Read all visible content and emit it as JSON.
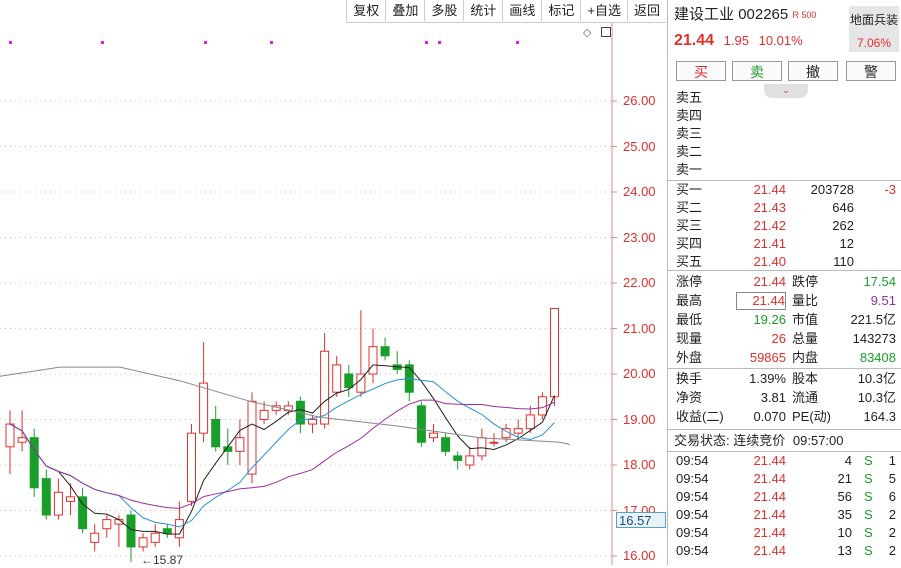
{
  "toolbar": [
    "复权",
    "叠加",
    "多股",
    "统计",
    "画线",
    "标记",
    "+自选",
    "返回"
  ],
  "axis": {
    "ticks": [
      "26.00",
      "25.00",
      "24.00",
      "23.00",
      "22.00",
      "21.00",
      "20.00",
      "19.00",
      "18.00",
      "17.00",
      "16.00"
    ],
    "current_price": "16.57",
    "low_label": "15.87"
  },
  "chart_data": {
    "type": "candlestick",
    "ylim": [
      15.8,
      26.6
    ],
    "price_ticks": [
      26,
      25,
      24,
      23,
      22,
      21,
      20,
      19,
      18,
      17,
      16
    ],
    "candles": [
      {
        "o": 18.4,
        "c": 18.9,
        "h": 19.2,
        "l": 17.8
      },
      {
        "o": 18.5,
        "c": 18.6,
        "h": 19.2,
        "l": 18.3
      },
      {
        "o": 18.6,
        "c": 17.5,
        "h": 18.8,
        "l": 17.3
      },
      {
        "o": 17.7,
        "c": 16.9,
        "h": 17.9,
        "l": 16.8
      },
      {
        "o": 16.9,
        "c": 17.4,
        "h": 17.7,
        "l": 16.8
      },
      {
        "o": 17.2,
        "c": 17.3,
        "h": 17.6,
        "l": 16.9
      },
      {
        "o": 17.3,
        "c": 16.6,
        "h": 17.5,
        "l": 16.5
      },
      {
        "o": 16.3,
        "c": 16.5,
        "h": 16.7,
        "l": 16.1
      },
      {
        "o": 16.6,
        "c": 16.8,
        "h": 16.9,
        "l": 16.4
      },
      {
        "o": 16.7,
        "c": 16.8,
        "h": 16.9,
        "l": 16.2
      },
      {
        "o": 16.9,
        "c": 16.2,
        "h": 17.0,
        "l": 15.87
      },
      {
        "o": 16.2,
        "c": 16.4,
        "h": 16.5,
        "l": 16.1
      },
      {
        "o": 16.3,
        "c": 16.5,
        "h": 16.7,
        "l": 16.2
      },
      {
        "o": 16.6,
        "c": 16.5,
        "h": 16.7,
        "l": 16.4
      },
      {
        "o": 16.4,
        "c": 16.8,
        "h": 17.2,
        "l": 16.2
      },
      {
        "o": 17.2,
        "c": 18.7,
        "h": 18.9,
        "l": 17.1
      },
      {
        "o": 18.7,
        "c": 19.8,
        "h": 20.7,
        "l": 18.5
      },
      {
        "o": 19.0,
        "c": 18.4,
        "h": 19.3,
        "l": 18.3
      },
      {
        "o": 18.4,
        "c": 18.3,
        "h": 18.8,
        "l": 18.0
      },
      {
        "o": 18.3,
        "c": 18.6,
        "h": 19.0,
        "l": 18.0
      },
      {
        "o": 17.8,
        "c": 19.4,
        "h": 19.6,
        "l": 17.6
      },
      {
        "o": 19.0,
        "c": 19.2,
        "h": 19.4,
        "l": 18.9
      },
      {
        "o": 19.2,
        "c": 19.3,
        "h": 19.4,
        "l": 19.1
      },
      {
        "o": 19.2,
        "c": 19.3,
        "h": 19.4,
        "l": 19.1
      },
      {
        "o": 19.4,
        "c": 18.9,
        "h": 19.5,
        "l": 18.7
      },
      {
        "o": 18.9,
        "c": 19.0,
        "h": 19.1,
        "l": 18.7
      },
      {
        "o": 18.9,
        "c": 20.5,
        "h": 20.9,
        "l": 18.8
      },
      {
        "o": 19.6,
        "c": 20.2,
        "h": 20.4,
        "l": 19.5
      },
      {
        "o": 20.0,
        "c": 19.7,
        "h": 20.2,
        "l": 19.5
      },
      {
        "o": 19.6,
        "c": 20.0,
        "h": 21.4,
        "l": 19.5
      },
      {
        "o": 20.0,
        "c": 20.6,
        "h": 21.0,
        "l": 19.8
      },
      {
        "o": 20.6,
        "c": 20.4,
        "h": 20.8,
        "l": 20.3
      },
      {
        "o": 20.2,
        "c": 20.1,
        "h": 20.5,
        "l": 20.0
      },
      {
        "o": 20.2,
        "c": 19.6,
        "h": 20.3,
        "l": 19.4
      },
      {
        "o": 19.3,
        "c": 18.5,
        "h": 19.4,
        "l": 18.4
      },
      {
        "o": 18.6,
        "c": 18.7,
        "h": 18.9,
        "l": 18.5
      },
      {
        "o": 18.6,
        "c": 18.3,
        "h": 18.7,
        "l": 18.2
      },
      {
        "o": 18.2,
        "c": 18.1,
        "h": 18.3,
        "l": 17.9
      },
      {
        "o": 18.0,
        "c": 18.2,
        "h": 18.4,
        "l": 17.9
      },
      {
        "o": 18.2,
        "c": 18.6,
        "h": 18.8,
        "l": 18.1
      },
      {
        "o": 18.5,
        "c": 18.5,
        "h": 18.7,
        "l": 18.4
      },
      {
        "o": 18.6,
        "c": 18.8,
        "h": 18.9,
        "l": 18.5
      },
      {
        "o": 18.7,
        "c": 18.8,
        "h": 19.0,
        "l": 18.6
      },
      {
        "o": 18.8,
        "c": 19.1,
        "h": 19.3,
        "l": 18.7
      },
      {
        "o": 19.1,
        "c": 19.5,
        "h": 19.6,
        "l": 19.0
      },
      {
        "o": 19.5,
        "c": 21.44,
        "h": 21.44,
        "l": 19.3
      }
    ]
  },
  "quote": {
    "name": "建设工业",
    "code": "002265",
    "badge": "R 500",
    "price": "21.44",
    "change": "1.95",
    "change_pct": "10.01%",
    "sector": "地面兵装",
    "sector_pct": "7.06%"
  },
  "trade_buttons": [
    "买",
    "卖",
    "撤",
    "警"
  ],
  "sells": [
    "卖五",
    "卖四",
    "卖三",
    "卖二",
    "卖一"
  ],
  "buys": [
    {
      "label": "买一",
      "price": "21.44",
      "vol": "203728",
      "chg": "-3"
    },
    {
      "label": "买二",
      "price": "21.43",
      "vol": "646",
      "chg": ""
    },
    {
      "label": "买三",
      "price": "21.42",
      "vol": "262",
      "chg": ""
    },
    {
      "label": "买四",
      "price": "21.41",
      "vol": "12",
      "chg": ""
    },
    {
      "label": "买五",
      "price": "21.40",
      "vol": "110",
      "chg": ""
    }
  ],
  "stats": [
    {
      "l1": "涨停",
      "v1": "21.44",
      "c1": "red",
      "l2": "跌停",
      "v2": "17.54",
      "c2": "green"
    },
    {
      "l1": "最高",
      "v1": "21.44",
      "c1": "red",
      "l2": "量比",
      "v2": "9.51",
      "c2": "purple"
    },
    {
      "l1": "最低",
      "v1": "19.26",
      "c1": "green",
      "l2": "市值",
      "v2": "221.5亿",
      "c2": ""
    },
    {
      "l1": "现量",
      "v1": "26",
      "c1": "red",
      "l2": "总量",
      "v2": "143273",
      "c2": ""
    },
    {
      "l1": "外盘",
      "v1": "59865",
      "c1": "red",
      "l2": "内盘",
      "v2": "83408",
      "c2": "green"
    }
  ],
  "fin": [
    {
      "l1": "换手",
      "v1": "1.39%",
      "l2": "股本",
      "v2": "10.3亿"
    },
    {
      "l1": "净资",
      "v1": "3.81",
      "l2": "流通",
      "v2": "10.3亿"
    },
    {
      "l1": "收益(二)",
      "v1": "0.070",
      "l2": "PE(动)",
      "v2": "164.3"
    }
  ],
  "status": {
    "label": "交易状态:",
    "value": "连续竞价",
    "time": "09:57:00"
  },
  "ticks": [
    {
      "t": "09:54",
      "p": "21.44",
      "v": "4",
      "s": "S",
      "n": "1"
    },
    {
      "t": "09:54",
      "p": "21.44",
      "v": "21",
      "s": "S",
      "n": "5"
    },
    {
      "t": "09:54",
      "p": "21.44",
      "v": "56",
      "s": "S",
      "n": "6"
    },
    {
      "t": "09:54",
      "p": "21.44",
      "v": "35",
      "s": "S",
      "n": "2"
    },
    {
      "t": "09:54",
      "p": "21.44",
      "v": "10",
      "s": "S",
      "n": "2"
    },
    {
      "t": "09:54",
      "p": "21.44",
      "v": "13",
      "s": "S",
      "n": "2"
    }
  ]
}
